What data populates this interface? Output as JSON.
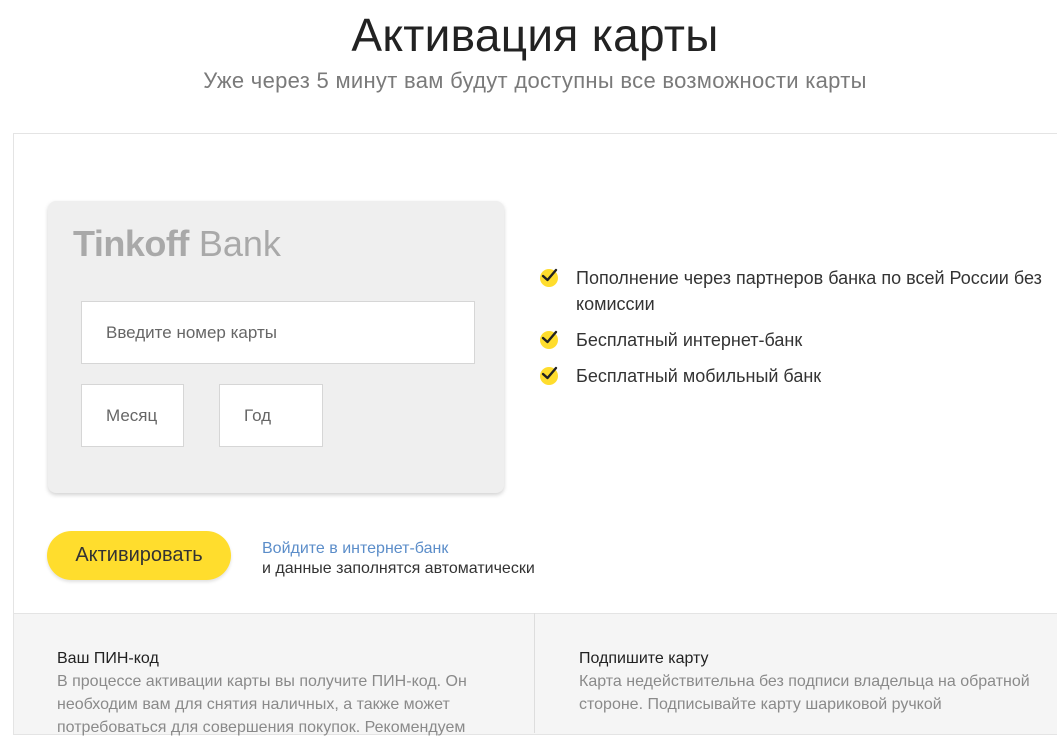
{
  "header": {
    "title": "Активация карты",
    "subtitle": "Уже через 5 минут вам будут доступны все возможности карты"
  },
  "card": {
    "logo_bold": "Tinkoff",
    "logo_light": "Bank",
    "card_number_placeholder": "Введите номер карты",
    "month_placeholder": "Месяц",
    "year_placeholder": "Год"
  },
  "features": [
    {
      "icon": "checkmark-icon",
      "text": "Пополнение через партнеров банка по всей России без комиссии"
    },
    {
      "icon": "checkmark-icon",
      "text": "Бесплатный интернет-банк"
    },
    {
      "icon": "checkmark-icon",
      "text": "Бесплатный мобильный банк"
    }
  ],
  "actions": {
    "activate_label": "Активировать",
    "login_link": "Войдите в интернет-банк",
    "login_note": "и данные заполнятся автоматически"
  },
  "info": {
    "pin_title": "Ваш ПИН-код",
    "pin_text": "В процессе активации карты вы получите ПИН-код. Он необходим вам для снятия наличных, а также может потребоваться для совершения покупок. Рекомендуем",
    "sign_title": "Подпишите карту",
    "sign_text": "Карта недействительна без подписи владельца на обратной стороне. Подписывайте карту шариковой ручкой"
  },
  "colors": {
    "accent": "#ffdd2d",
    "link": "#5b8dc9",
    "logo": "#a9a9a9"
  }
}
